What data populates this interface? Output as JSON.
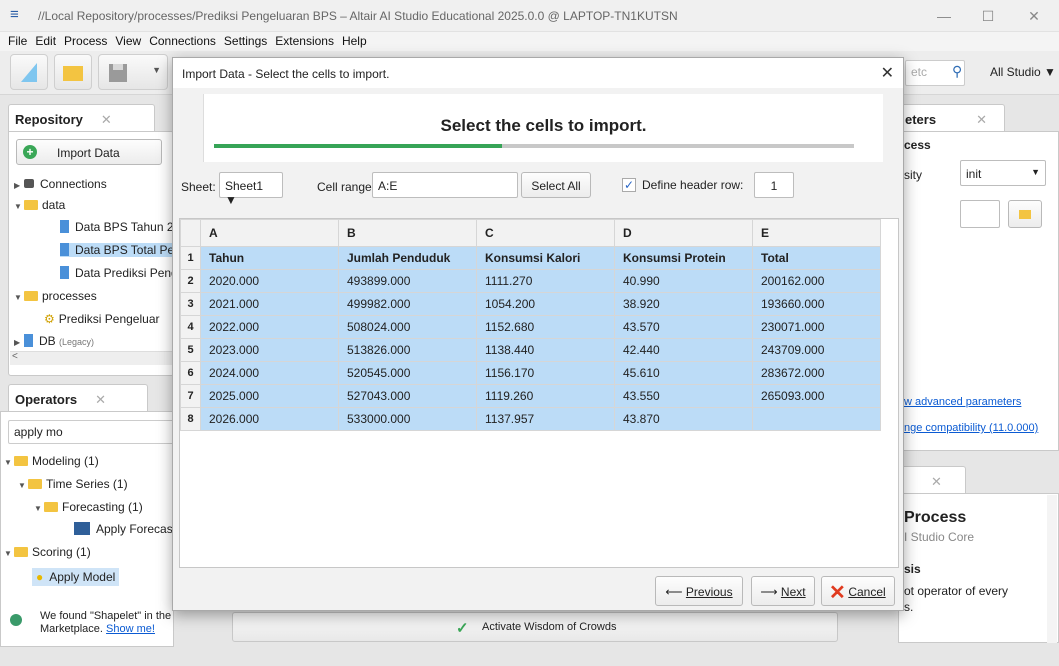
{
  "window": {
    "title": "//Local Repository/processes/Prediksi Pengeluaran BPS – Altair AI Studio Educational 2025.0.0 @ LAPTOP-TN1KUTSN",
    "minimize": "—",
    "maximize": "☐",
    "close": "✕"
  },
  "menu": [
    "File",
    "Edit",
    "Process",
    "View",
    "Connections",
    "Settings",
    "Extensions",
    "Help"
  ],
  "toolbar": {
    "search_placeholder": "etc",
    "scope": "All Studio ▼"
  },
  "repository": {
    "tab": "Repository",
    "import_button": "Import Data",
    "items": [
      "Connections",
      "data",
      "Data BPS Tahun 2",
      "Data BPS Total Pe",
      "Data Prediksi Peng",
      "processes",
      "Prediksi Pengeluar",
      "DB",
      "(Legacy)"
    ]
  },
  "operators": {
    "tab": "Operators",
    "search_value": "apply mo",
    "tree": [
      "Modeling (1)",
      "Time Series (1)",
      "Forecasting (1)",
      "Apply Forecast",
      "Scoring (1)",
      "Apply Model"
    ],
    "marketplace_text": "We found \"Shapelet\" in the",
    "marketplace_text2": "Marketplace.",
    "show_me": "Show me!"
  },
  "parameters": {
    "tab": "eters",
    "cess": "cess",
    "sity_label": "sity",
    "sity_value": "init",
    "advanced_link": "w advanced parameters",
    "compat_link": "nge compatibility (11.0.000)"
  },
  "help": {
    "title": "Process",
    "subtitle": "I Studio Core",
    "sis": "sis",
    "desc1": "ot operator of every",
    "desc2": "s."
  },
  "wisdom": {
    "label": "Activate Wisdom of Crowds"
  },
  "dialog": {
    "title": "Import Data - Select the cells to import.",
    "heading": "Select the cells to import.",
    "progress": 0.45,
    "sheet_label": "Sheet:",
    "sheet_value": "Sheet1 ▼",
    "range_label": "Cell range:",
    "range_value": "A:E",
    "select_all": "Select All",
    "define_header": "Define header row:",
    "header_row": "1",
    "columns": [
      "A",
      "B",
      "C",
      "D",
      "E"
    ],
    "rows": [
      [
        "1",
        "Tahun",
        "Jumlah Penduduk",
        "Konsumsi Kalori",
        "Konsumsi Protein",
        "Total"
      ],
      [
        "2",
        "2020.000",
        "493899.000",
        "1111.270",
        "40.990",
        "200162.000"
      ],
      [
        "3",
        "2021.000",
        "499982.000",
        "1054.200",
        "38.920",
        "193660.000"
      ],
      [
        "4",
        "2022.000",
        "508024.000",
        "1152.680",
        "43.570",
        "230071.000"
      ],
      [
        "5",
        "2023.000",
        "513826.000",
        "1138.440",
        "42.440",
        "243709.000"
      ],
      [
        "6",
        "2024.000",
        "520545.000",
        "1156.170",
        "45.610",
        "283672.000"
      ],
      [
        "7",
        "2025.000",
        "527043.000",
        "1119.260",
        "43.550",
        "265093.000"
      ],
      [
        "8",
        "2026.000",
        "533000.000",
        "1137.957",
        "43.870",
        ""
      ]
    ],
    "previous": "Previous",
    "next": "Next",
    "cancel": "Cancel"
  }
}
